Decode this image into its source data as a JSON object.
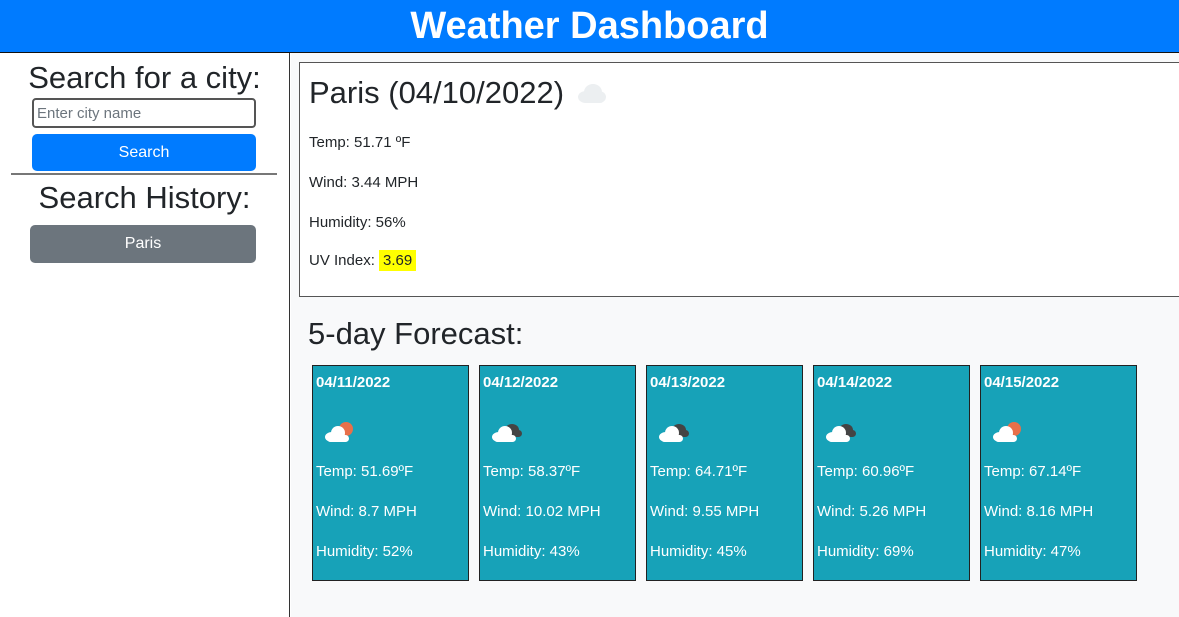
{
  "header": {
    "title": "Weather Dashboard"
  },
  "sidebar": {
    "search_title": "Search for a city:",
    "search_placeholder": "Enter city name",
    "search_button": "Search",
    "history_title": "Search History:",
    "history": [
      "Paris"
    ]
  },
  "current": {
    "title": "Paris (04/10/2022)",
    "icon": "cloud-icon",
    "temp": "Temp: 51.71 ºF",
    "wind": "Wind: 3.44 MPH",
    "humidity": "Humidity: 56%",
    "uv_label": "UV Index: ",
    "uv_value": "3.69",
    "uv_color": "#ffff00"
  },
  "forecast": {
    "title": "5-day Forecast:",
    "card_color": "#17a2b8",
    "days": [
      {
        "date": "04/11/2022",
        "icon": "partly-cloudy-sun-icon",
        "temp": "Temp: 51.69ºF",
        "wind": "Wind: 8.7 MPH",
        "humidity": "Humidity: 52%"
      },
      {
        "date": "04/12/2022",
        "icon": "broken-clouds-icon",
        "temp": "Temp: 58.37ºF",
        "wind": "Wind: 10.02 MPH",
        "humidity": "Humidity: 43%"
      },
      {
        "date": "04/13/2022",
        "icon": "broken-clouds-icon",
        "temp": "Temp: 64.71ºF",
        "wind": "Wind: 9.55 MPH",
        "humidity": "Humidity: 45%"
      },
      {
        "date": "04/14/2022",
        "icon": "broken-clouds-icon",
        "temp": "Temp: 60.96ºF",
        "wind": "Wind: 5.26 MPH",
        "humidity": "Humidity: 69%"
      },
      {
        "date": "04/15/2022",
        "icon": "partly-cloudy-sun-icon",
        "temp": "Temp: 67.14ºF",
        "wind": "Wind: 8.16 MPH",
        "humidity": "Humidity: 47%"
      }
    ]
  }
}
